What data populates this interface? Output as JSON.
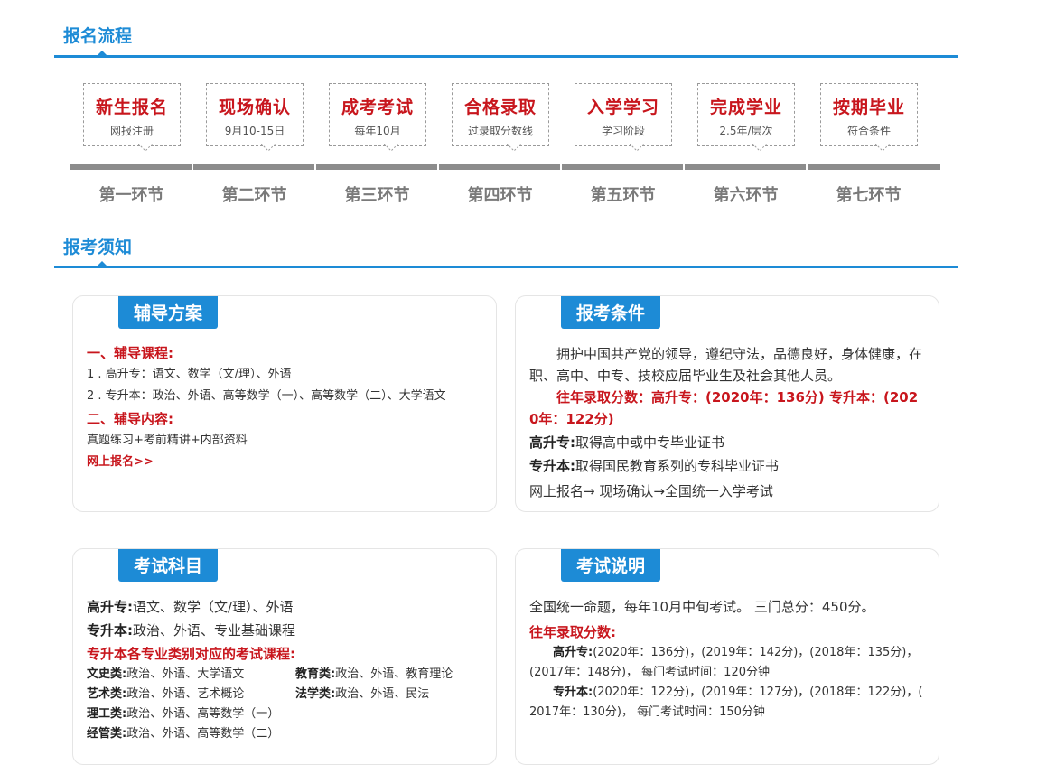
{
  "section1": {
    "title": "报名流程"
  },
  "section2": {
    "title": "报考须知"
  },
  "steps": [
    {
      "title": "新生报名",
      "sub": "网报注册",
      "label": "第一环节"
    },
    {
      "title": "现场确认",
      "sub": "9月10-15日",
      "label": "第二环节"
    },
    {
      "title": "成考考试",
      "sub": "每年10月",
      "label": "第三环节"
    },
    {
      "title": "合格录取",
      "sub": "过录取分数线",
      "label": "第四环节"
    },
    {
      "title": "入学学习",
      "sub": "学习阶段",
      "label": "第五环节"
    },
    {
      "title": "完成学业",
      "sub": "2.5年/层次",
      "label": "第六环节"
    },
    {
      "title": "按期毕业",
      "sub": "符合条件",
      "label": "第七环节"
    }
  ],
  "tutoring": {
    "tab": "辅导方案",
    "h1": "一、辅导课程:",
    "line1": "1 . 高升专：语文、数学（文/理）、外语",
    "line2": "2 . 专升本：政治、外语、高等数学（一）、高等数学（二）、大学语文",
    "h2": "二、辅导内容:",
    "content": "真题练习+考前精讲+内部资料",
    "link": "网上报名>>"
  },
  "conditions": {
    "tab": "报考条件",
    "para": "拥护中国共产党的领导，遵纪守法，品德良好，身体健康，在职、高中、中专、技校应届毕业生及社会其他人员。",
    "score": "往年录取分数：高升专：(2020年：136分) 专升本：(2020年：122分)",
    "gsz_label": "高升专:",
    "gsz_text": "取得高中或中专毕业证书",
    "zsb_label": "专升本:",
    "zsb_text": "取得国民教育系列的专科毕业证书",
    "flow": "网上报名→ 现场确认→全国统一入学考试"
  },
  "subjects": {
    "tab": "考试科目",
    "gsz_label": "高升专:",
    "gsz_text": "语文、数学（文/理）、外语",
    "zsb_label": "专升本:",
    "zsb_text": "政治、外语、专业基础课程",
    "heading": "专升本各专业类别对应的考试课程:",
    "items": [
      {
        "label": "文史类:",
        "text": "政治、外语、大学语文"
      },
      {
        "label": "教育类:",
        "text": "政治、外语、教育理论"
      },
      {
        "label": "艺术类:",
        "text": "政治、外语、艺术概论"
      },
      {
        "label": "法学类:",
        "text": "政治、外语、民法"
      },
      {
        "label": "理工类:",
        "text": "政治、外语、高等数学（一）"
      },
      {
        "label": "经管类:",
        "text": "政治、外语、高等数学（二）"
      }
    ]
  },
  "exam": {
    "tab": "考试说明",
    "line1": "全国统一命题，每年10月中旬考试。 三门总分：450分。",
    "heading": "往年录取分数:",
    "gsz_label": "高升专:",
    "gsz_text": "(2020年：136分)，(2019年：142分)，(2018年：135分)，(2017年：148分)， 每门考试时间：120分钟",
    "zsb_label": "专升本:",
    "zsb_text": "(2020年：122分)，(2019年：127分)，(2018年：122分)，( 2017年：130分)， 每门考试时间：150分钟"
  },
  "colors": {
    "blue": "#1d8bd6",
    "red": "#c8161d",
    "bar": "#8c8c8c"
  }
}
